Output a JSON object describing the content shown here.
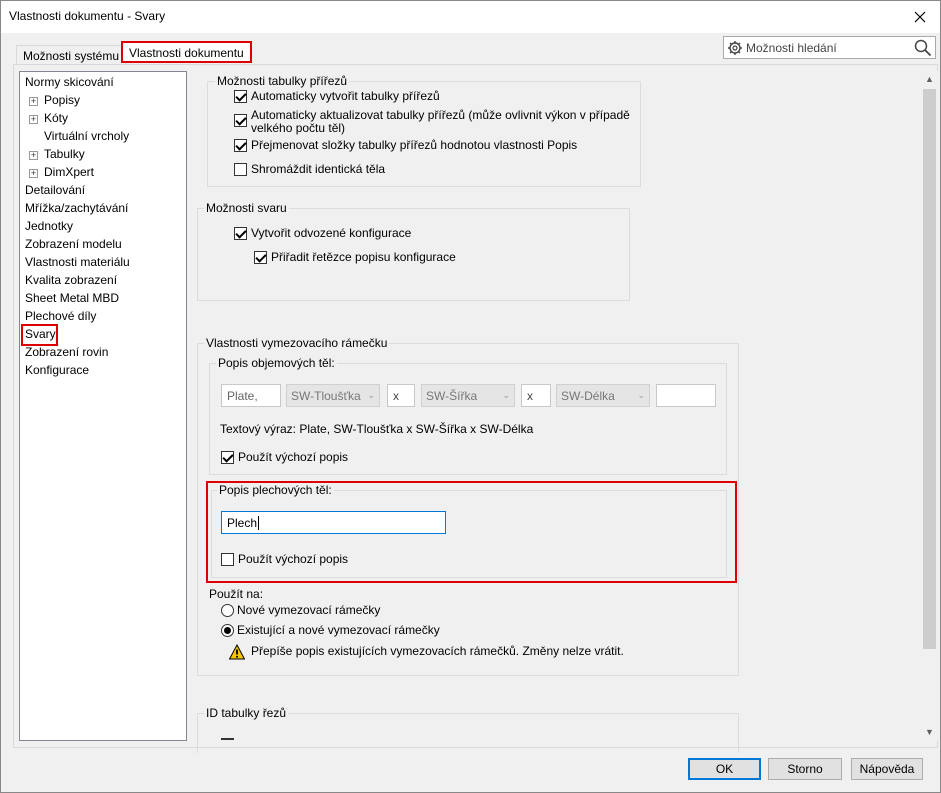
{
  "window": {
    "title": "Vlastnosti dokumentu - Svary",
    "close_icon": "close-icon"
  },
  "tabs": [
    {
      "label": "Možnosti systému",
      "active": false
    },
    {
      "label": "Vlastnosti dokumentu",
      "active": true
    }
  ],
  "search": {
    "placeholder": "Možnosti hledání"
  },
  "tree": {
    "items": [
      {
        "label": "Normy skicování",
        "expander": false
      },
      {
        "label": "Popisy",
        "expander": true
      },
      {
        "label": "Kóty",
        "expander": true
      },
      {
        "label": "Virtuální vrcholy",
        "expander": false
      },
      {
        "label": "Tabulky",
        "expander": true
      },
      {
        "label": "DimXpert",
        "expander": true
      },
      {
        "label": "Detailování",
        "expander": false
      },
      {
        "label": "Mřížka/zachytávání",
        "expander": false
      },
      {
        "label": "Jednotky",
        "expander": false
      },
      {
        "label": "Zobrazení modelu",
        "expander": false
      },
      {
        "label": "Vlastnosti materiálu",
        "expander": false
      },
      {
        "label": "Kvalita zobrazení",
        "expander": false
      },
      {
        "label": "Sheet Metal MBD",
        "expander": false
      },
      {
        "label": "Plechové díly",
        "expander": false
      },
      {
        "label": "Svary",
        "expander": false,
        "selected": true
      },
      {
        "label": "Zobrazení rovin",
        "expander": false
      },
      {
        "label": "Konfigurace",
        "expander": false
      }
    ]
  },
  "cutlist": {
    "group_label": "Možnosti tabulky přířezů",
    "options": [
      {
        "label": "Automaticky vytvořit tabulky přířezů",
        "checked": true
      },
      {
        "label": "Automaticky aktualizovat tabulky přířezů (může ovlivnit výkon v případě",
        "label2": "velkého počtu těl)",
        "checked": true
      },
      {
        "label": "Přejmenovat složky tabulky přířezů hodnotou vlastnosti Popis",
        "checked": true
      },
      {
        "label": "Shromáždit identická těla",
        "checked": false
      }
    ]
  },
  "weld": {
    "group_label": "Možnosti svaru",
    "options": [
      {
        "label": "Vytvořit odvozené konfigurace",
        "checked": true
      },
      {
        "label": "Přiřadit řetězce popisu konfigurace",
        "checked": true
      }
    ]
  },
  "bbox": {
    "group_label": "Vlastnosti vymezovacího rámečku",
    "volume": {
      "label": "Popis objemových těl:",
      "field1": "Plate,",
      "combo1": "SW-Tloušťka",
      "sep1": "x",
      "combo2": "SW-Šířka",
      "sep2": "x",
      "combo3": "SW-Délka",
      "field_last": "",
      "expression": "Textový výraz: Plate, SW-Tloušťka x SW-Šířka x SW-Délka",
      "default_label": "Použít výchozí popis",
      "default_checked": true
    },
    "sheet": {
      "label": "Popis plechových těl:",
      "value": "Plech",
      "default_label": "Použít výchozí popis",
      "default_checked": false
    },
    "apply": {
      "label": "Použít na:",
      "option1": "Nové vymezovací rámečky",
      "option2": "Existující a nové vymezovací rámečky",
      "selected": 2,
      "warning": "Přepíše popis existujících vymezovacích rámečků. Změny nelze vrátit."
    }
  },
  "cut_id": {
    "group_label": "ID tabulky řezů"
  },
  "buttons": {
    "ok": "OK",
    "cancel": "Storno",
    "help": "Nápověda"
  },
  "colors": {
    "highlight": "#dd0000",
    "focus": "#0078d7"
  }
}
